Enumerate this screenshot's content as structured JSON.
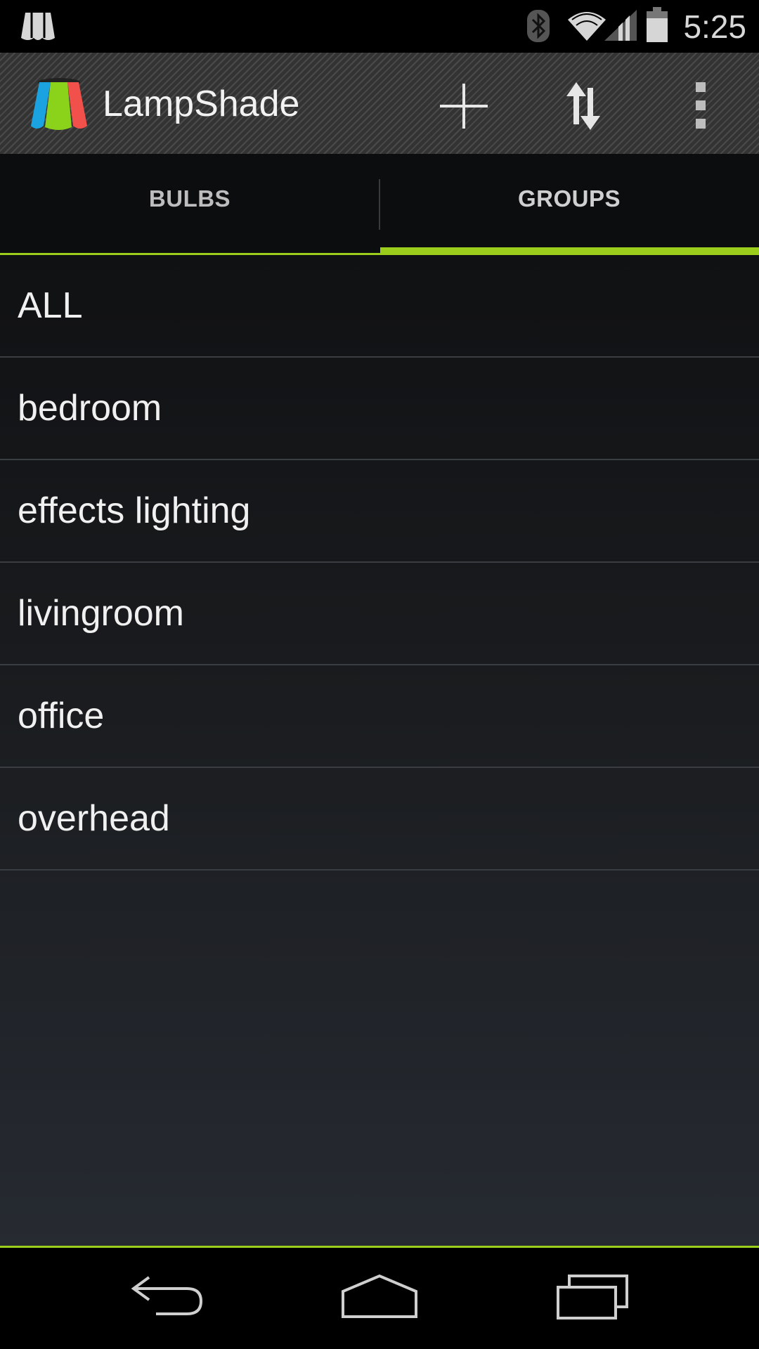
{
  "status_bar": {
    "time": "5:25",
    "icons": [
      "lampshade-notification-icon",
      "bluetooth-icon",
      "wifi-icon",
      "cell-signal-icon",
      "battery-icon"
    ]
  },
  "action_bar": {
    "title": "LampShade",
    "actions": [
      "add-icon",
      "sync-icon",
      "overflow-menu-icon"
    ]
  },
  "tabs": [
    {
      "label": "BULBS",
      "selected": false
    },
    {
      "label": "GROUPS",
      "selected": true
    }
  ],
  "groups": [
    {
      "label": "ALL"
    },
    {
      "label": "bedroom"
    },
    {
      "label": "effects lighting"
    },
    {
      "label": "livingroom"
    },
    {
      "label": "office"
    },
    {
      "label": "overhead"
    }
  ],
  "nav_bar": {
    "buttons": [
      "back-icon",
      "home-icon",
      "recents-icon"
    ]
  },
  "colors": {
    "accent": "#9acd1c",
    "background": "#111214",
    "text": "#f0f0f0"
  }
}
